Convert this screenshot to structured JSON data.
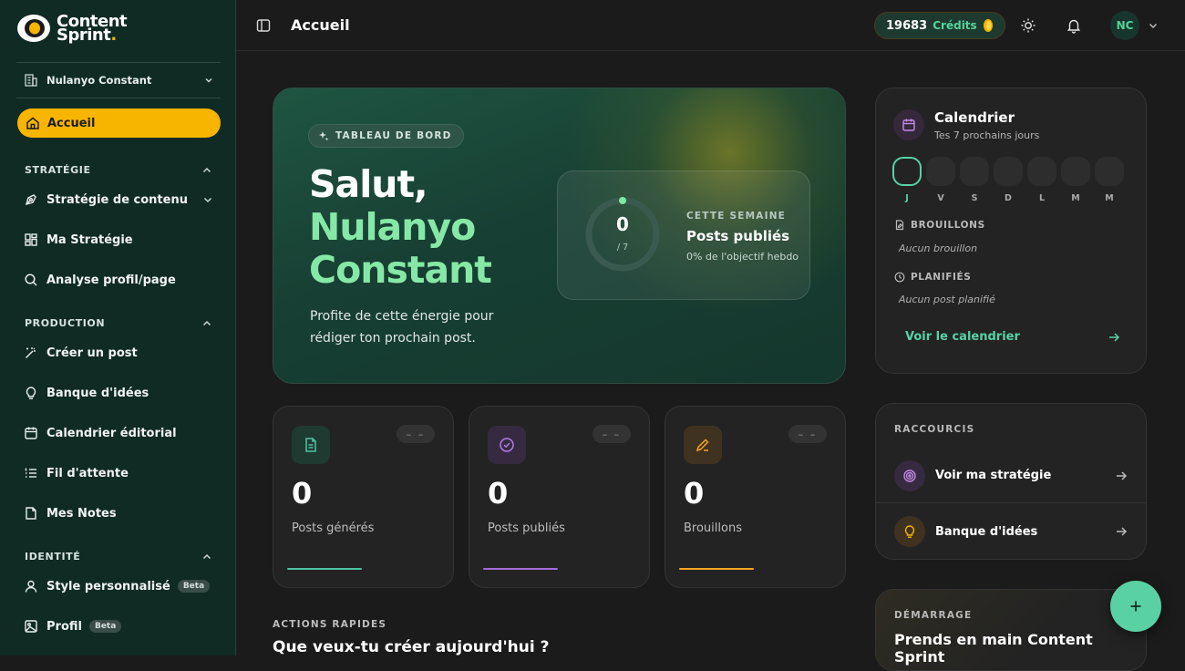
{
  "brand": {
    "name_line1": "Content",
    "name_line2": "Sprint",
    "name_dot": "."
  },
  "workspace": {
    "name": "Nulanyo Constant"
  },
  "nav": {
    "home": "Accueil",
    "sections": [
      {
        "title": "STRATÉGIE",
        "items": [
          "Stratégie de contenu",
          "Ma Stratégie",
          "Analyse profil/page"
        ]
      },
      {
        "title": "PRODUCTION",
        "items": [
          "Créer un post",
          "Banque d'idées",
          "Calendrier éditorial",
          "Fil d'attente",
          "Mes Notes"
        ]
      },
      {
        "title": "IDENTITÉ",
        "items": [
          "Style personnalisé",
          "Profil"
        ]
      }
    ],
    "beta": "Beta"
  },
  "header": {
    "title": "Accueil",
    "credits_value": "19683",
    "credits_label": "Crédits",
    "avatar": "NC"
  },
  "hero": {
    "badge": "TABLEAU DE BORD",
    "greeting": "Salut,",
    "name_line1": "Nulanyo",
    "name_line2": "Constant",
    "subtitle": "Profite de cette énergie pour rédiger ton prochain post.",
    "week": {
      "label": "CETTE SEMAINE",
      "title": "Posts publiés",
      "goal_text": "0% de l'objectif hebdo",
      "value": "0",
      "goal": "/ 7",
      "progress": 0
    }
  },
  "stats": [
    {
      "value": "0",
      "label": "Posts générés",
      "trend": "– –",
      "icon": "document-icon",
      "color": "#4fc3a1"
    },
    {
      "value": "0",
      "label": "Posts publiés",
      "trend": "– –",
      "icon": "check-circle-icon",
      "color": "#a66bd8"
    },
    {
      "value": "0",
      "label": "Brouillons",
      "trend": "– –",
      "icon": "pencil-icon",
      "color": "#f5a623"
    }
  ],
  "quick_actions": {
    "label": "ACTIONS RAPIDES",
    "title": "Que veux-tu créer aujourd'hui ?"
  },
  "calendar": {
    "title": "Calendrier",
    "subtitle": "Tes 7 prochains jours",
    "days": [
      "J",
      "V",
      "S",
      "D",
      "L",
      "M",
      "M"
    ],
    "drafts_label": "BROUILLONS",
    "drafts_empty": "Aucun brouillon",
    "scheduled_label": "PLANIFIÉS",
    "scheduled_empty": "Aucun post planifié",
    "link": "Voir le calendrier"
  },
  "shortcuts": {
    "label": "RACCOURCIS",
    "items": [
      "Voir ma stratégie",
      "Banque d'idées"
    ]
  },
  "onboarding": {
    "label": "DÉMARRAGE",
    "title": "Prends en main Content Sprint"
  },
  "colors": {
    "accent": "#f7b500",
    "green": "#56d3a5",
    "sidebar": "#0f2b24"
  }
}
